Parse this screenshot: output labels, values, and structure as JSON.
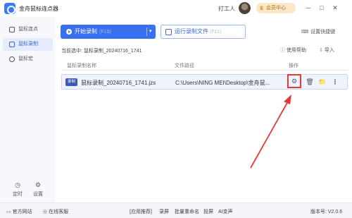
{
  "titlebar": {
    "app_title": "金舟鼠标连点器",
    "user_name": "打工人",
    "vip_label": "会员中心",
    "minimize": "─",
    "maximize": "□",
    "close": "✕"
  },
  "sidebar": {
    "items": [
      {
        "label": "鼠标连点"
      },
      {
        "label": "鼠标录制"
      },
      {
        "label": "鼠标宏"
      }
    ],
    "bottom": [
      {
        "label": "定时",
        "glyph": "◷"
      },
      {
        "label": "设置",
        "glyph": "⚙"
      }
    ]
  },
  "toolbar": {
    "start_label": "开始录制",
    "start_hotkey": "(F10)",
    "caret": "▾",
    "run_label": "运行录制文件",
    "run_hotkey": "(F11)",
    "hotkey_settings": "设置快捷键"
  },
  "current": {
    "label": "当前选中: 鼠标录制_20240716_1741",
    "help": "使用帮助",
    "import": "导入"
  },
  "table": {
    "headers": [
      "鼠标录制名称",
      "文件路径",
      "操作"
    ],
    "rows": [
      {
        "badge": "录制",
        "name": "鼠标录制_20240716_1741.jzs",
        "path": "C:\\Users\\NING MEI\\Desktop\\金舟鼠..."
      }
    ]
  },
  "row_actions": {
    "settings_icon": "⚙",
    "delete_icon": "🗑",
    "folder_icon": "📁",
    "more_icon": "⋮"
  },
  "statusbar": {
    "website": "官方网站",
    "service": "在线客服",
    "links": [
      "[应用推荐]",
      "录屏",
      "批量重命名",
      "投屏",
      "AI变声"
    ],
    "version": "版本号: V2.0.6"
  },
  "colors": {
    "accent": "#3a6ff0",
    "highlight_box": "#e53935",
    "annotation_arrow": "#e53935"
  }
}
